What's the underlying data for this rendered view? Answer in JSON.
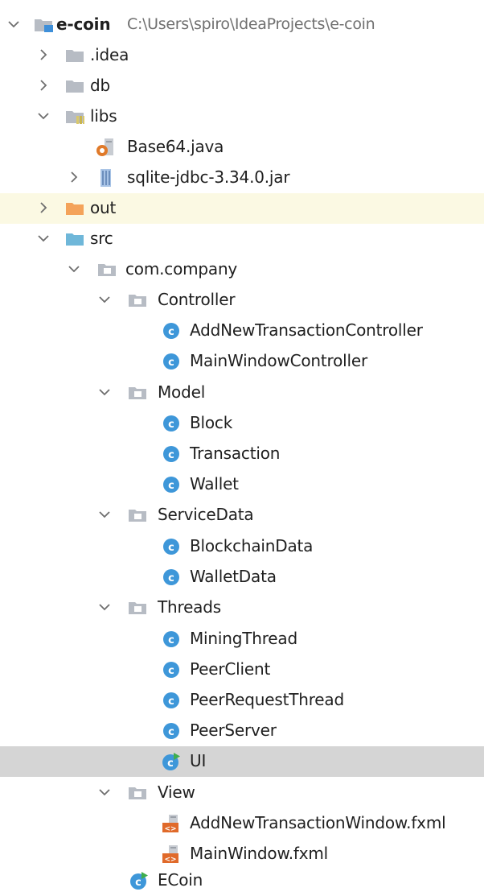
{
  "project": {
    "name": "e-coin",
    "path": "C:\\Users\\spiro\\IdeaProjects\\e-coin"
  },
  "colors": {
    "folder": "#b7bcc4",
    "folder_excluded": "#f4a35a",
    "folder_source": "#6fb7d9",
    "class_circle": "#3e97d9",
    "highlight_row": "#fbf9e3",
    "selected_row": "#d5d5d5",
    "path_text": "#707070"
  },
  "nodes": [
    {
      "label": "e-coin",
      "icon": "module-folder-icon",
      "expanded": true
    },
    {
      "label": ".idea",
      "icon": "folder-icon",
      "expanded": false
    },
    {
      "label": "db",
      "icon": "folder-icon",
      "expanded": false
    },
    {
      "label": "libs",
      "icon": "library-folder-icon",
      "expanded": true
    },
    {
      "label": "Base64.java",
      "icon": "java-file-icon"
    },
    {
      "label": "sqlite-jdbc-3.34.0.jar",
      "icon": "jar-icon",
      "expanded": false
    },
    {
      "label": "out",
      "icon": "excluded-folder-icon",
      "expanded": false
    },
    {
      "label": "src",
      "icon": "source-folder-icon",
      "expanded": true
    },
    {
      "label": "com.company",
      "icon": "package-icon",
      "expanded": true
    },
    {
      "label": "Controller",
      "icon": "package-icon",
      "expanded": true
    },
    {
      "label": "AddNewTransactionController",
      "icon": "class-icon"
    },
    {
      "label": "MainWindowController",
      "icon": "class-icon"
    },
    {
      "label": "Model",
      "icon": "package-icon",
      "expanded": true
    },
    {
      "label": "Block",
      "icon": "class-icon"
    },
    {
      "label": "Transaction",
      "icon": "class-icon"
    },
    {
      "label": "Wallet",
      "icon": "class-icon"
    },
    {
      "label": "ServiceData",
      "icon": "package-icon",
      "expanded": true
    },
    {
      "label": "BlockchainData",
      "icon": "class-icon"
    },
    {
      "label": "WalletData",
      "icon": "class-icon"
    },
    {
      "label": "Threads",
      "icon": "package-icon",
      "expanded": true
    },
    {
      "label": "MiningThread",
      "icon": "class-icon"
    },
    {
      "label": "PeerClient",
      "icon": "class-icon"
    },
    {
      "label": "PeerRequestThread",
      "icon": "class-icon"
    },
    {
      "label": "PeerServer",
      "icon": "class-icon"
    },
    {
      "label": "UI",
      "icon": "runnable-class-icon",
      "selected": true
    },
    {
      "label": "View",
      "icon": "package-icon",
      "expanded": true
    },
    {
      "label": "AddNewTransactionWindow.fxml",
      "icon": "fxml-file-icon"
    },
    {
      "label": "MainWindow.fxml",
      "icon": "fxml-file-icon"
    },
    {
      "label": "ECoin",
      "icon": "runnable-class-icon"
    }
  ]
}
